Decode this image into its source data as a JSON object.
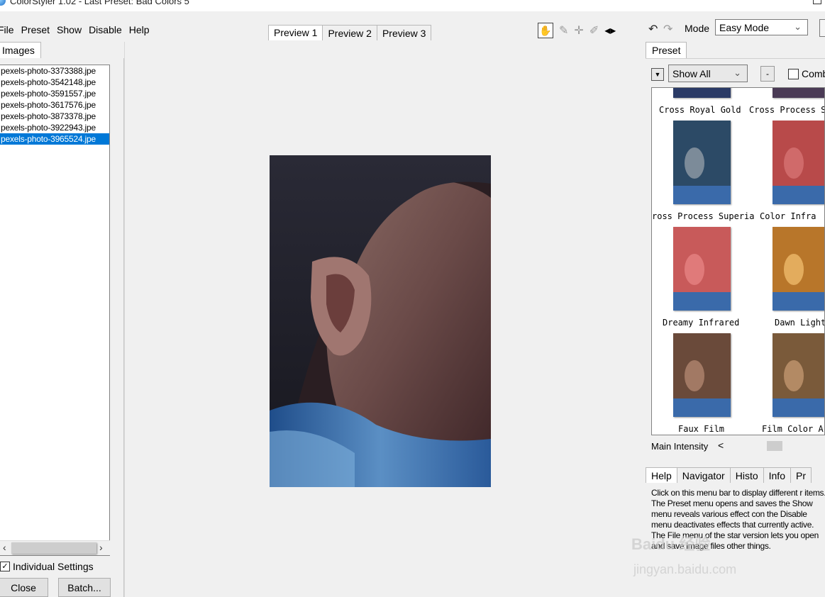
{
  "window": {
    "title": "ColorStyler 1.02 - Last Preset: Bad Colors 5"
  },
  "menu": [
    "File",
    "Preset",
    "Show",
    "Disable",
    "Help"
  ],
  "preview_tabs": [
    {
      "label": "Preview 1",
      "active": true
    },
    {
      "label": "Preview 2",
      "active": false
    },
    {
      "label": "Preview 3",
      "active": false
    }
  ],
  "toolbar": {
    "tools": [
      "hand-icon",
      "eyedropper-icon",
      "crosshair-icon",
      "brush-icon",
      "split-arrows-icon"
    ],
    "mode_label": "Mode",
    "mode_value": "Easy Mode"
  },
  "left_panel": {
    "tab": "Images",
    "files": [
      {
        "name": "pexels-photo-3373388.jpe",
        "selected": false
      },
      {
        "name": "pexels-photo-3542148.jpe",
        "selected": false
      },
      {
        "name": "pexels-photo-3591557.jpe",
        "selected": false
      },
      {
        "name": "pexels-photo-3617576.jpe",
        "selected": false
      },
      {
        "name": "pexels-photo-3873378.jpe",
        "selected": false
      },
      {
        "name": "pexels-photo-3922943.jpe",
        "selected": false
      },
      {
        "name": "pexels-photo-3965524.jpe",
        "selected": true
      }
    ],
    "individual_settings": "Individual Settings",
    "individual_checked": true,
    "close_label": "Close",
    "batch_label": "Batch..."
  },
  "preset_panel": {
    "tab": "Preset",
    "show_value": "Show All",
    "minus_label": "-",
    "comb_label": "Comb",
    "thumbnails": [
      {
        "label": "Cross Royal Gold",
        "tint": "#2a3a66"
      },
      {
        "label": "Cross Process S",
        "tint": "#4a3a55"
      },
      {
        "label": "ross Process Superia",
        "tint": "#2c4a66"
      },
      {
        "label": "Color Infra",
        "tint": "#b84a4a"
      },
      {
        "label": "Dreamy Infrared",
        "tint": "#c85a5a"
      },
      {
        "label": "Dawn Light",
        "tint": "#b8762a"
      },
      {
        "label": "Faux Film",
        "tint": "#6a4a3a"
      },
      {
        "label": "Film Color A",
        "tint": "#7a5a3a"
      }
    ],
    "main_intensity_label": "Main Intensity",
    "intensity_arrow": "<"
  },
  "help_panel": {
    "tabs": [
      {
        "label": "Help",
        "active": true
      },
      {
        "label": "Navigator",
        "active": false
      },
      {
        "label": "Histo",
        "active": false
      },
      {
        "label": "Info",
        "active": false
      },
      {
        "label": "Pr",
        "active": false
      }
    ],
    "text": "Click on this menu bar to display different r items. The Preset menu opens and saves the Show menu reveals various effect con the Disable menu deactivates effects that currently active. The File menu of the star version lets you open and save image files other things."
  },
  "watermark": {
    "line1": "Baidu 经验",
    "line2": "jingyan.baidu.com"
  }
}
